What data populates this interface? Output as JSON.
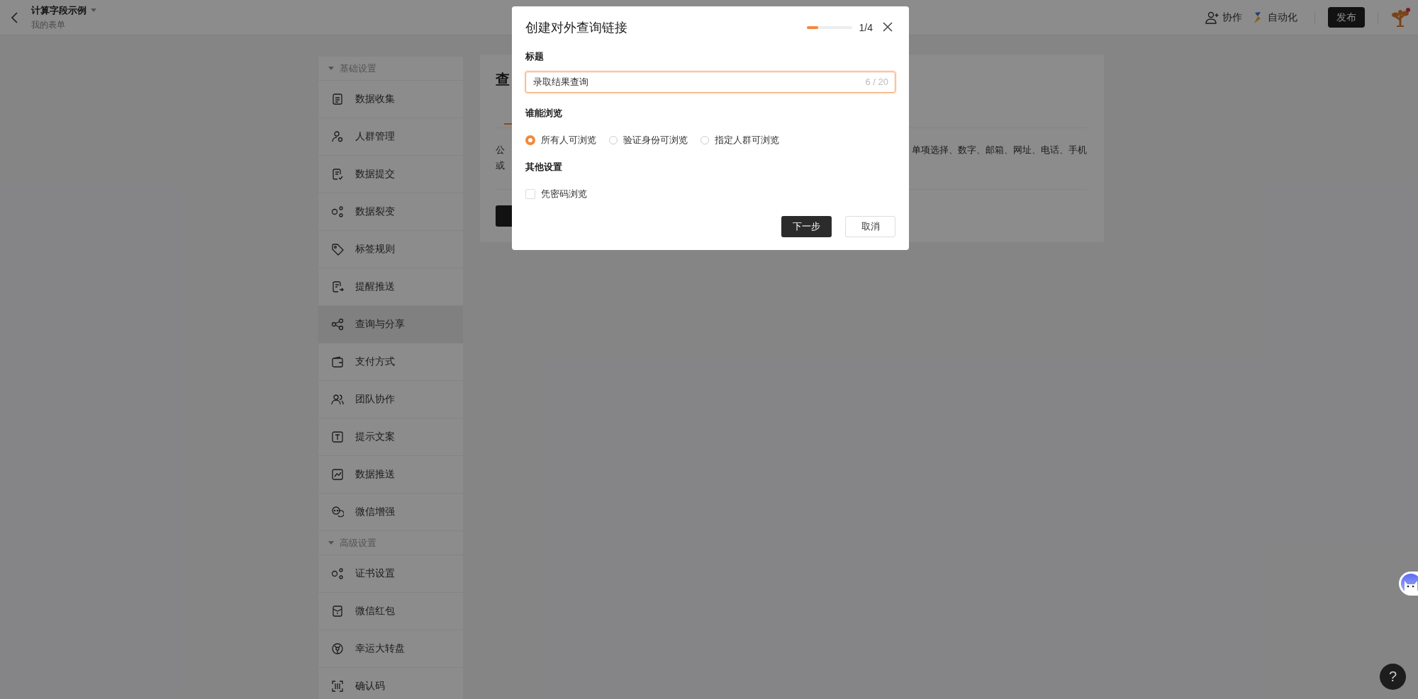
{
  "header": {
    "title": "计算字段示例",
    "subtitle": "我的表单",
    "actions": [
      {
        "kind": "collab",
        "label": "协作"
      },
      {
        "kind": "automation",
        "label": "自动化"
      }
    ],
    "publish": "发布"
  },
  "sidebar": {
    "groups": [
      {
        "title": "基础设置",
        "expanded": true,
        "items": [
          {
            "label": "数据收集",
            "selected": false
          },
          {
            "label": "人群管理",
            "selected": false
          },
          {
            "label": "数据提交",
            "selected": false
          },
          {
            "label": "数据裂变",
            "selected": false
          },
          {
            "label": "标签规则",
            "selected": false
          },
          {
            "label": "提醒推送",
            "selected": false
          },
          {
            "label": "查询与分享",
            "selected": true
          },
          {
            "label": "支付方式",
            "selected": false
          },
          {
            "label": "团队协作",
            "selected": false
          },
          {
            "label": "提示文案",
            "selected": false
          },
          {
            "label": "数据推送",
            "selected": false
          },
          {
            "label": "微信增强",
            "selected": false
          }
        ]
      },
      {
        "title": "高级设置",
        "expanded": true,
        "items": [
          {
            "label": "证书设置",
            "selected": false
          },
          {
            "label": "微信红包",
            "selected": false
          },
          {
            "label": "幸运大转盘",
            "selected": false
          },
          {
            "label": "确认码",
            "selected": false
          }
        ]
      }
    ]
  },
  "card": {
    "title": "查",
    "tab": {
      "selected": true
    },
    "text_left": [
      "公",
      "或"
    ],
    "text_right": "单项选择、数字、邮箱、网址、电话、手机"
  },
  "help": "?",
  "dialog": {
    "title": "创建对外查询链接",
    "progress": {
      "level": 0.25,
      "reading": "1/4"
    },
    "title_field": {
      "label": "标题",
      "value": "录取结果查询",
      "counter": "6 / 20"
    },
    "visibility": {
      "label": "谁能浏览",
      "options": [
        {
          "label": "所有人可浏览",
          "selected": true
        },
        {
          "label": "验证身份可浏览",
          "selected": false
        },
        {
          "label": "指定人群可浏览",
          "selected": false
        }
      ]
    },
    "other": {
      "label": "其他设置",
      "options": [
        {
          "label": "凭密码浏览",
          "checked": false
        }
      ]
    },
    "buttons": [
      {
        "kind": "primary",
        "label": "下一步"
      },
      {
        "kind": "secondary",
        "label": "取消"
      }
    ]
  }
}
